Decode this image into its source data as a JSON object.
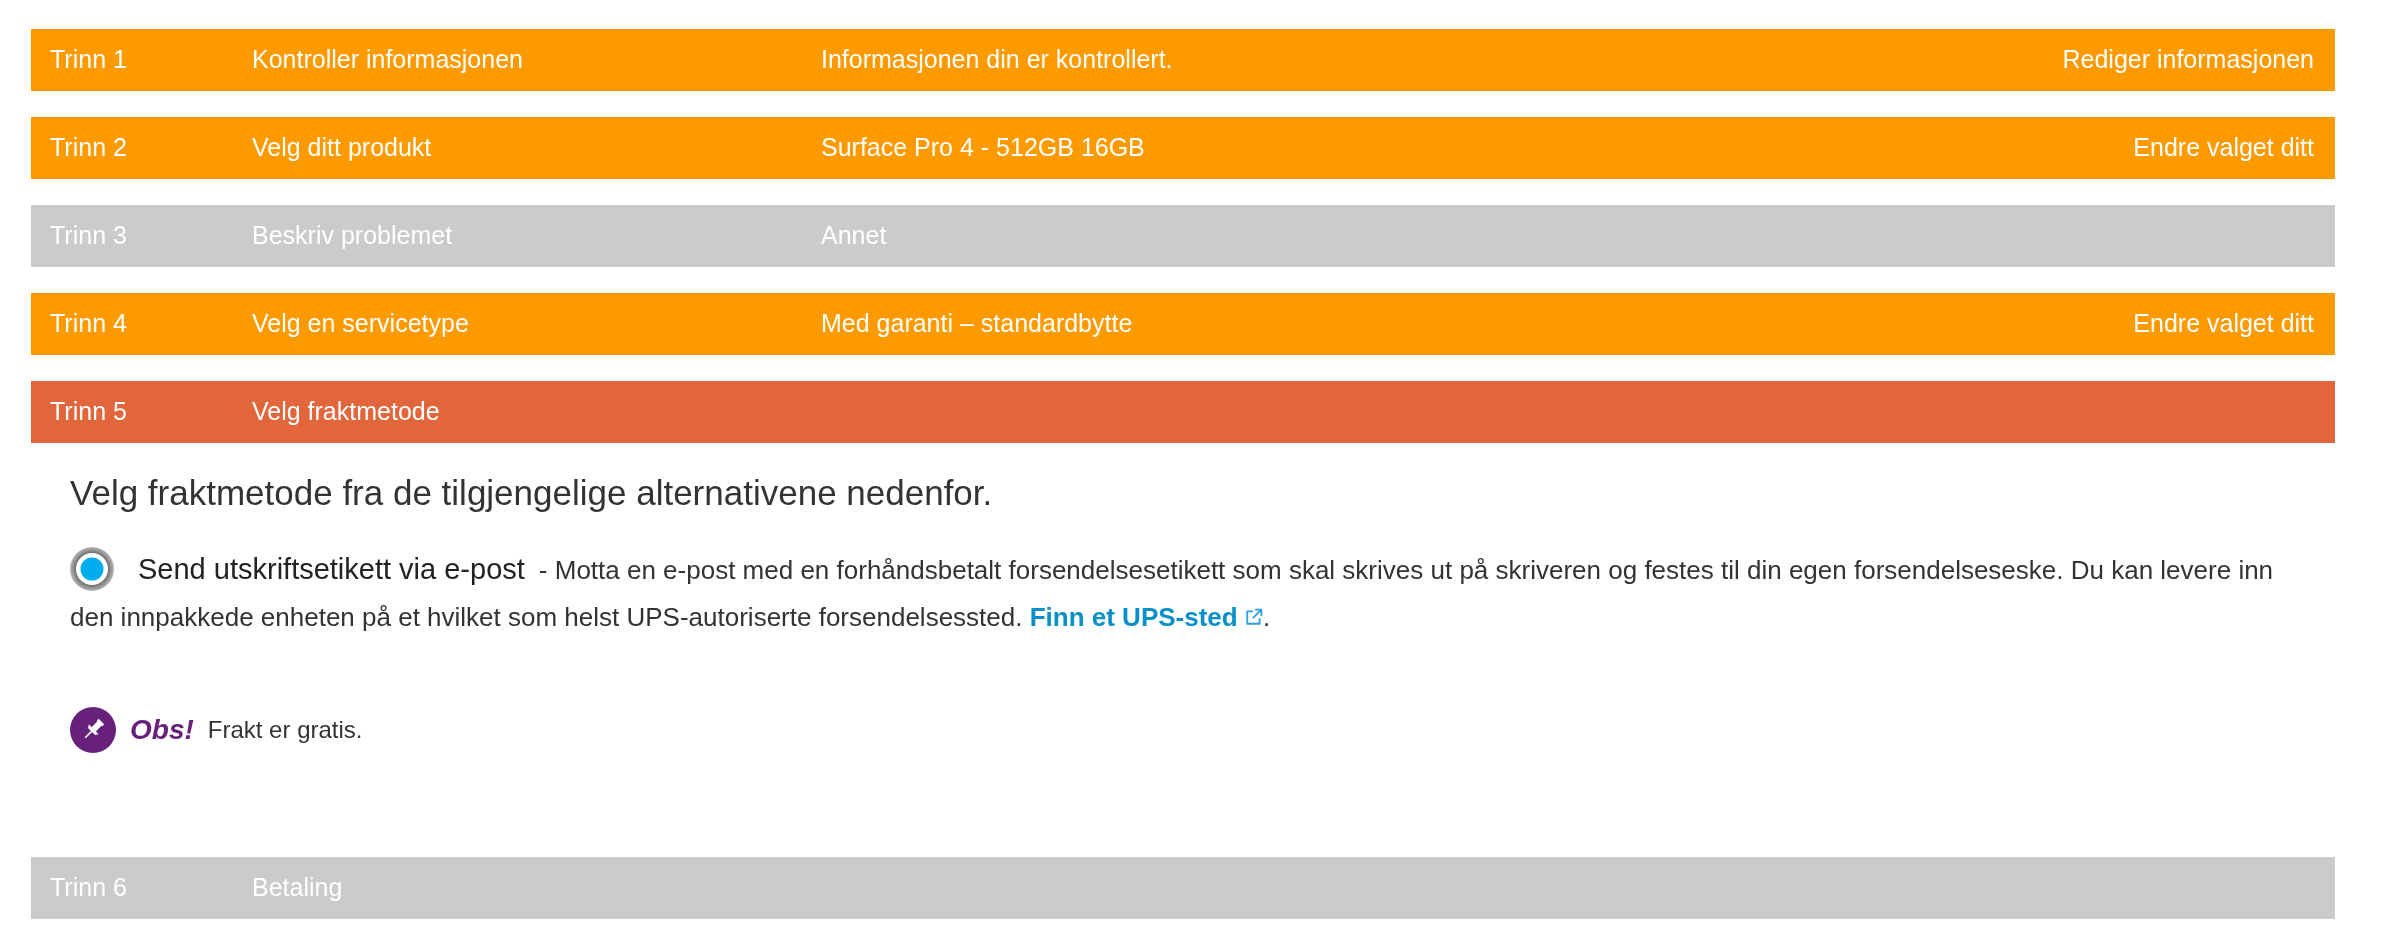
{
  "steps": [
    {
      "label": "Trinn 1",
      "title": "Kontroller informasjonen",
      "value": "Informasjonen din er kontrollert.",
      "action": "Rediger informasjonen",
      "color": "#fd9a00"
    },
    {
      "label": "Trinn 2",
      "title": "Velg ditt produkt",
      "value": "Surface Pro 4 - 512GB 16GB",
      "action": "Endre valget ditt",
      "color": "#fd9a00"
    },
    {
      "label": "Trinn 3",
      "title": "Beskriv problemet",
      "value": "Annet",
      "color": "#cbcbcb"
    },
    {
      "label": "Trinn 4",
      "title": "Velg en servicetype",
      "value": "Med garanti – standardbytte",
      "action": "Endre valget ditt",
      "color": "#fd9a00"
    },
    {
      "label": "Trinn 5",
      "title": "Velg fraktmetode",
      "color": "#e2663b",
      "panel": {
        "heading": "Velg fraktmetode fra de tilgjengelige alternativene nedenfor.",
        "options": [
          {
            "label": "Send utskriftsetikett via e-post",
            "selected": true,
            "description": "- Motta en e-post med en forhåndsbetalt forsendelsesetikett som skal skrives ut på skriveren og festes til din egen forsendelseseske. Du kan levere inn den innpakkede enheten på et hvilket som helst UPS-autoriserte forsendelsessted.",
            "link": "Finn et UPS-sted",
            "description_end": "."
          }
        ],
        "note": {
          "title": "Obs!",
          "text": "Frakt er gratis."
        }
      }
    },
    {
      "label": "Trinn 6",
      "title": "Betaling",
      "color": "#cbcbcb"
    }
  ]
}
